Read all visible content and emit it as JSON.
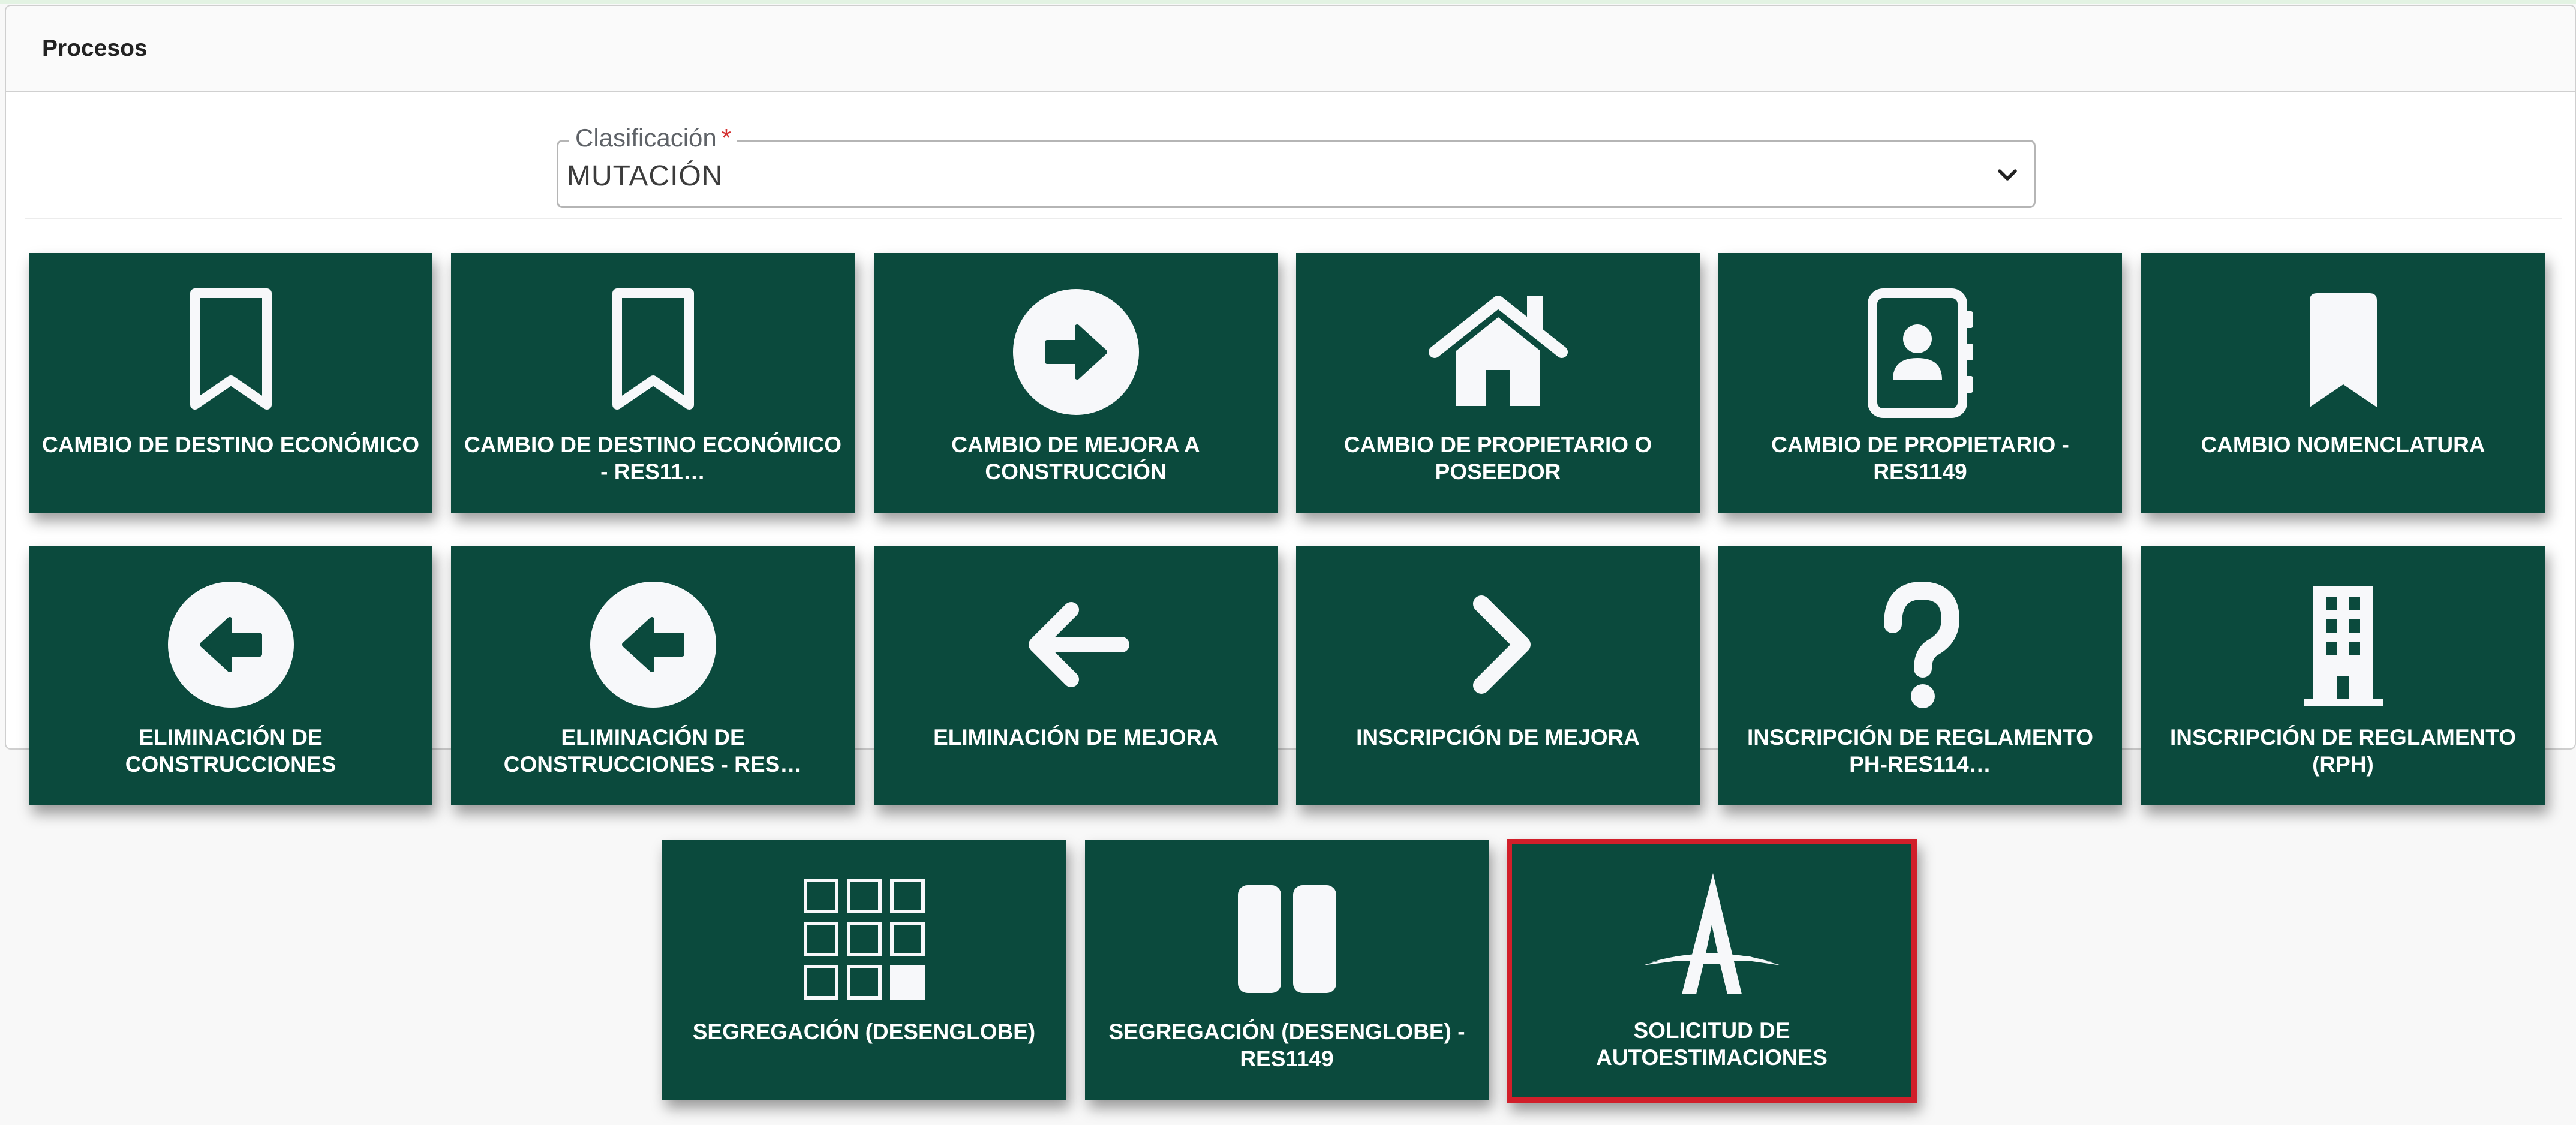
{
  "panel": {
    "title": "Procesos"
  },
  "clasificacion": {
    "label": "Clasificación",
    "required_mark": "*",
    "value": "MUTACIÓN"
  },
  "tiles": [
    {
      "label": "CAMBIO DE DESTINO ECONÓMICO",
      "icon": "bookmark-outline-icon"
    },
    {
      "label": "CAMBIO DE DESTINO ECONÓMICO - RES11…",
      "icon": "bookmark-outline-icon"
    },
    {
      "label": "CAMBIO DE MEJORA A CONSTRUCCIÓN",
      "icon": "circle-arrow-right-icon"
    },
    {
      "label": "CAMBIO DE PROPIETARIO O POSEEDOR",
      "icon": "house-icon"
    },
    {
      "label": "CAMBIO DE PROPIETARIO - RES1149",
      "icon": "address-book-icon"
    },
    {
      "label": "CAMBIO NOMENCLATURA",
      "icon": "bookmark-solid-icon"
    },
    {
      "label": "ELIMINACIÓN DE CONSTRUCCIONES",
      "icon": "circle-arrow-left-icon"
    },
    {
      "label": "ELIMINACIÓN DE CONSTRUCCIONES - RES…",
      "icon": "circle-arrow-left-icon"
    },
    {
      "label": "ELIMINACIÓN DE MEJORA",
      "icon": "arrow-left-icon"
    },
    {
      "label": "INSCRIPCIÓN DE MEJORA",
      "icon": "chevron-right-icon"
    },
    {
      "label": "INSCRIPCIÓN DE REGLAMENTO PH-RES114…",
      "icon": "question-icon"
    },
    {
      "label": "INSCRIPCIÓN DE REGLAMENTO (RPH)",
      "icon": "building-icon"
    },
    {
      "label": "SEGREGACIÓN (DESENGLOBE)",
      "icon": "grid-icon"
    },
    {
      "label": "SEGREGACIÓN (DESENGLOBE) - RES1149",
      "icon": "pause-icon"
    },
    {
      "label": "SOLICITUD DE AUTOESTIMACIONES",
      "icon": "autoestimacion-logo-icon",
      "selected": true
    }
  ],
  "colors": {
    "tile_bg": "#0b4a3d",
    "selected_border": "#d11f2a",
    "icon_fill": "#f7f8fa"
  }
}
